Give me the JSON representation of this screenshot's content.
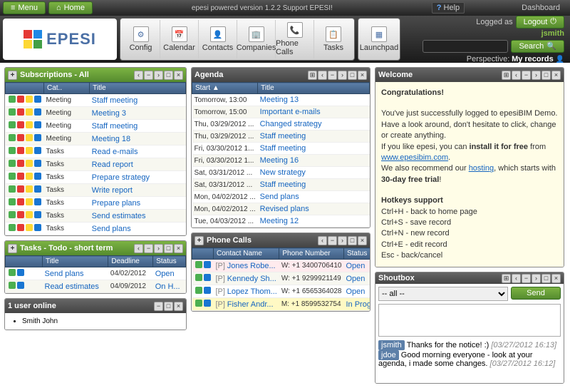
{
  "topbar": {
    "menu": "Menu",
    "home": "Home",
    "center": "epesi powered  version 1.2.2   Support EPESI!",
    "help": "Help",
    "dashboard": "Dashboard"
  },
  "user": {
    "logged_as": "Logged as",
    "username": "jsmith",
    "logout": "Logout",
    "search": "Search",
    "perspective_label": "Perspective:",
    "perspective": "My records"
  },
  "tools": [
    {
      "label": "Config",
      "icon": "⚙"
    },
    {
      "label": "Calendar",
      "icon": "📅"
    },
    {
      "label": "Contacts",
      "icon": "👤"
    },
    {
      "label": "Companies",
      "icon": "🏢"
    },
    {
      "label": "Phone Calls",
      "icon": "📞"
    },
    {
      "label": "Tasks",
      "icon": "📋"
    }
  ],
  "launchpad": {
    "label": "Launchpad",
    "icon": "▦"
  },
  "subscriptions": {
    "title": "Subscriptions - All",
    "cols": {
      "cat": "Cat..",
      "title": "Title"
    },
    "rows": [
      {
        "cat": "Meeting",
        "title": "Staff meeting"
      },
      {
        "cat": "Meeting",
        "title": "Meeting 3"
      },
      {
        "cat": "Meeting",
        "title": "Staff meeting"
      },
      {
        "cat": "Meeting",
        "title": "Meeting 18"
      },
      {
        "cat": "Tasks",
        "title": "Read e-mails"
      },
      {
        "cat": "Tasks",
        "title": "Read report"
      },
      {
        "cat": "Tasks",
        "title": "Prepare strategy"
      },
      {
        "cat": "Tasks",
        "title": "Write report"
      },
      {
        "cat": "Tasks",
        "title": "Prepare plans"
      },
      {
        "cat": "Tasks",
        "title": "Send estimates"
      },
      {
        "cat": "Tasks",
        "title": "Send plans"
      }
    ]
  },
  "tasks": {
    "title": "Tasks - Todo - short term",
    "cols": {
      "title": "Title",
      "deadline": "Deadline",
      "status": "Status"
    },
    "rows": [
      {
        "title": "Send plans",
        "deadline": "04/02/2012",
        "status": "Open"
      },
      {
        "title": "Read estimates",
        "deadline": "04/09/2012",
        "status": "On H..."
      }
    ]
  },
  "online": {
    "title": "1 user online",
    "user": "Smith John"
  },
  "agenda": {
    "title": "Agenda",
    "cols": {
      "start": "Start ▲",
      "title": "Title"
    },
    "rows": [
      {
        "start": "Tomorrow, 13:00",
        "title": "Meeting 13"
      },
      {
        "start": "Tomorrow, 15:00",
        "title": "Important e-mails"
      },
      {
        "start": "Thu, 03/29/2012 ...",
        "title": "Changed strategy"
      },
      {
        "start": "Thu, 03/29/2012 ...",
        "title": "Staff meeting"
      },
      {
        "start": "Fri, 03/30/2012 1...",
        "title": "Staff meeting"
      },
      {
        "start": "Fri, 03/30/2012 1...",
        "title": "Meeting 16"
      },
      {
        "start": "Sat, 03/31/2012 ...",
        "title": "New strategy"
      },
      {
        "start": "Sat, 03/31/2012 ...",
        "title": "Staff meeting"
      },
      {
        "start": "Mon, 04/02/2012 ...",
        "title": "Send plans"
      },
      {
        "start": "Mon, 04/02/2012 ...",
        "title": "Revised plans"
      },
      {
        "start": "Tue, 04/03/2012 ...",
        "title": "Meeting 12"
      }
    ]
  },
  "phone": {
    "title": "Phone Calls",
    "cols": {
      "contact": "Contact Name",
      "number": "Phone Number",
      "status": "Status"
    },
    "rows": [
      {
        "p": "[P]",
        "contact": "Jones Robe...",
        "number": "W: +1 3400706410",
        "status": "Open",
        "cls": "row-pink"
      },
      {
        "p": "[P]",
        "contact": "Kennedy Sh...",
        "number": "W: +1 9299921149",
        "status": "Open",
        "cls": ""
      },
      {
        "p": "[P]",
        "contact": "Lopez Thom...",
        "number": "W: +1 6565364028",
        "status": "Open",
        "cls": ""
      },
      {
        "p": "[P]",
        "contact": "Fisher Andr...",
        "number": "M: +1 8599532754",
        "status": "In Prog...",
        "cls": "row-yel"
      }
    ]
  },
  "welcome": {
    "title": "Welcome",
    "heading": "Congratulations!",
    "l1": "You've just successfully logged to epesiBIM Demo. Have a look around, don't hesitate to click, change or create anything.",
    "l2a": "If you like epesi, you can ",
    "l2b": "install it for free",
    "l2c": " from ",
    "link": "www.epesibim.com",
    "l2d": ".",
    "l3a": "We also recommend our ",
    "l3b": "hosting",
    "l3c": ", which starts with ",
    "l3d": "30-day free trial",
    "l3e": "!",
    "hk": "Hotkeys support",
    "hk1": "Ctrl+H - back to home page",
    "hk2": "Ctrl+S - save record",
    "hk3": "Ctrl+N - new record",
    "hk4": "Ctrl+E - edit record",
    "hk5": "Esc - back/cancel"
  },
  "shout": {
    "title": "Shoutbox",
    "all": "-- all --",
    "send": "Send",
    "msgs": [
      {
        "user": "jsmith",
        "text": "Thanks for the notice! :)",
        "time": "[03/27/2012 16:13]"
      },
      {
        "user": "jdoe",
        "text": "Good morning everyone - look at your agenda, i made some changes.",
        "time": "[03/27/2012 16:12]"
      }
    ]
  }
}
